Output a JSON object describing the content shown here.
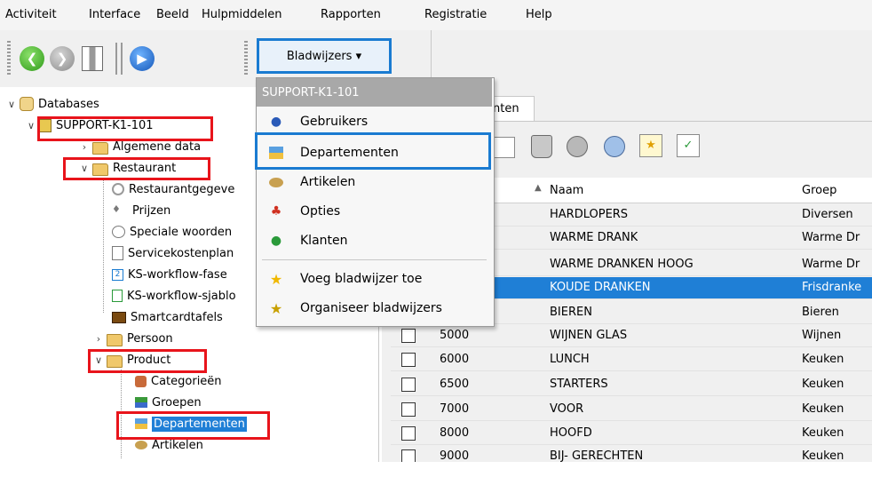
{
  "menubar": {
    "items": [
      "Activiteit",
      "Interface",
      "Beeld",
      "Hulpmiddelen",
      "Rapporten",
      "Registratie",
      "Help"
    ]
  },
  "toolbar": {
    "bookmarks_label": "Bladwijzers ▾"
  },
  "bookmarks_menu": {
    "header": "SUPPORT-K1-101",
    "items": [
      {
        "label": "Gebruikers",
        "icon": "users-icon"
      },
      {
        "label": "Departementen",
        "icon": "departments-icon"
      },
      {
        "label": "Artikelen",
        "icon": "articles-icon"
      },
      {
        "label": "Opties",
        "icon": "options-icon"
      },
      {
        "label": "Klanten",
        "icon": "customers-icon"
      },
      {
        "label": "Voeg bladwijzer toe",
        "icon": "star-icon"
      },
      {
        "label": "Organiseer bladwijzers",
        "icon": "star-organize-icon"
      }
    ]
  },
  "tree": {
    "databases": "Databases",
    "server": "SUPPORT-K1-101",
    "algemene": "Algemene data",
    "restaurant": "Restaurant",
    "restaurant_children": [
      "Restaurantgegeve",
      "Prijzen",
      "Speciale woorden",
      "Servicekostenplan",
      "KS-workflow-fase",
      "KS-workflow-sjablo",
      "Smartcardtafels"
    ],
    "persoon": "Persoon",
    "product": "Product",
    "product_children": [
      "Categorieën",
      "Groepen",
      "Departementen",
      "Artikelen"
    ]
  },
  "tab": {
    "label": "nten"
  },
  "grid": {
    "headers": {
      "naam": "Naam",
      "groep": "Groep"
    },
    "rows": [
      {
        "code": "",
        "naam": "HARDLOPERS",
        "groep": "Diversen"
      },
      {
        "code": "",
        "naam": "WARME DRANK",
        "groep": "Warme Dr"
      },
      {
        "code": "",
        "naam": "WARME DRANKEN HOOG",
        "groep": "Warme Dr"
      },
      {
        "code": "",
        "naam": "KOUDE DRANKEN",
        "groep": "Frisdranke"
      },
      {
        "code": "",
        "naam": "BIEREN",
        "groep": "Bieren"
      },
      {
        "code": "5000",
        "naam": "WIJNEN GLAS",
        "groep": "Wijnen"
      },
      {
        "code": "6000",
        "naam": "LUNCH",
        "groep": "Keuken"
      },
      {
        "code": "6500",
        "naam": "STARTERS",
        "groep": "Keuken"
      },
      {
        "code": "7000",
        "naam": "VOOR",
        "groep": "Keuken"
      },
      {
        "code": "8000",
        "naam": "HOOFD",
        "groep": "Keuken"
      },
      {
        "code": "9000",
        "naam": "BIJ- GERECHTEN",
        "groep": "Keuken"
      }
    ]
  },
  "colors": {
    "highlight": "#e8141b",
    "accent": "#1a7bd1",
    "selection": "#1f7fd6"
  }
}
